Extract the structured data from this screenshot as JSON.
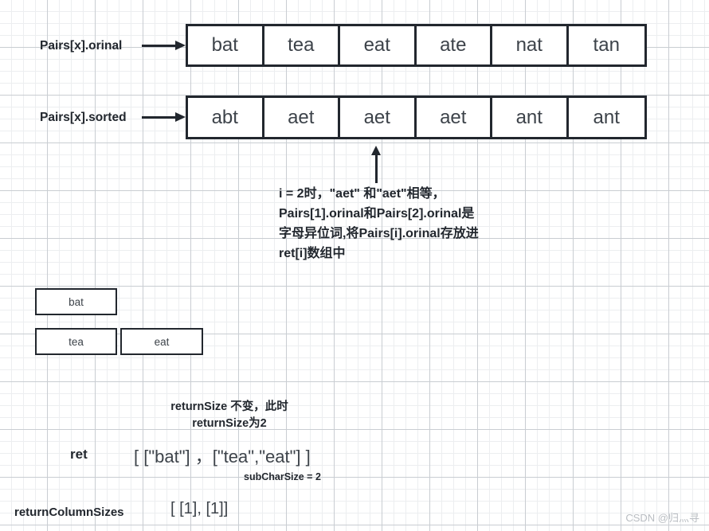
{
  "diagram": {
    "rows": [
      {
        "label": "Pairs[x].orinal",
        "cells": [
          "bat",
          "tea",
          "eat",
          "ate",
          "nat",
          "tan"
        ]
      },
      {
        "label": "Pairs[x].sorted",
        "cells": [
          "abt",
          "aet",
          "aet",
          "aet",
          "ant",
          "ant"
        ]
      }
    ],
    "annotation": "i = 2时，\"aet\" 和\"aet\"相等，Pairs[1].orinal和Pairs[2].orinal是字母异位词,将Pairs[i].orinal存放进ret[i]数组中",
    "group_boxes": [
      {
        "text": "bat"
      },
      {
        "text": "tea"
      },
      {
        "text": "eat"
      }
    ],
    "return_size_note": "returnSize 不变，此时returnSize为2",
    "ret_label": "ret",
    "ret_value": "[  [\"bat\"] ，[\"tea\",\"eat\"]  ]",
    "sub_char_size_note": "subCharSize = 2",
    "return_column_sizes_label": "returnColumnSizes",
    "return_column_sizes_value": "[ [1], [1]]",
    "watermark": "CSDN @归灬寻",
    "colors": {
      "stroke": "#22272e",
      "text": "#3d434a",
      "grid_minor": "#eceef0",
      "grid_major": "#c9cdd2",
      "watermark": "#b9bdc2"
    }
  }
}
